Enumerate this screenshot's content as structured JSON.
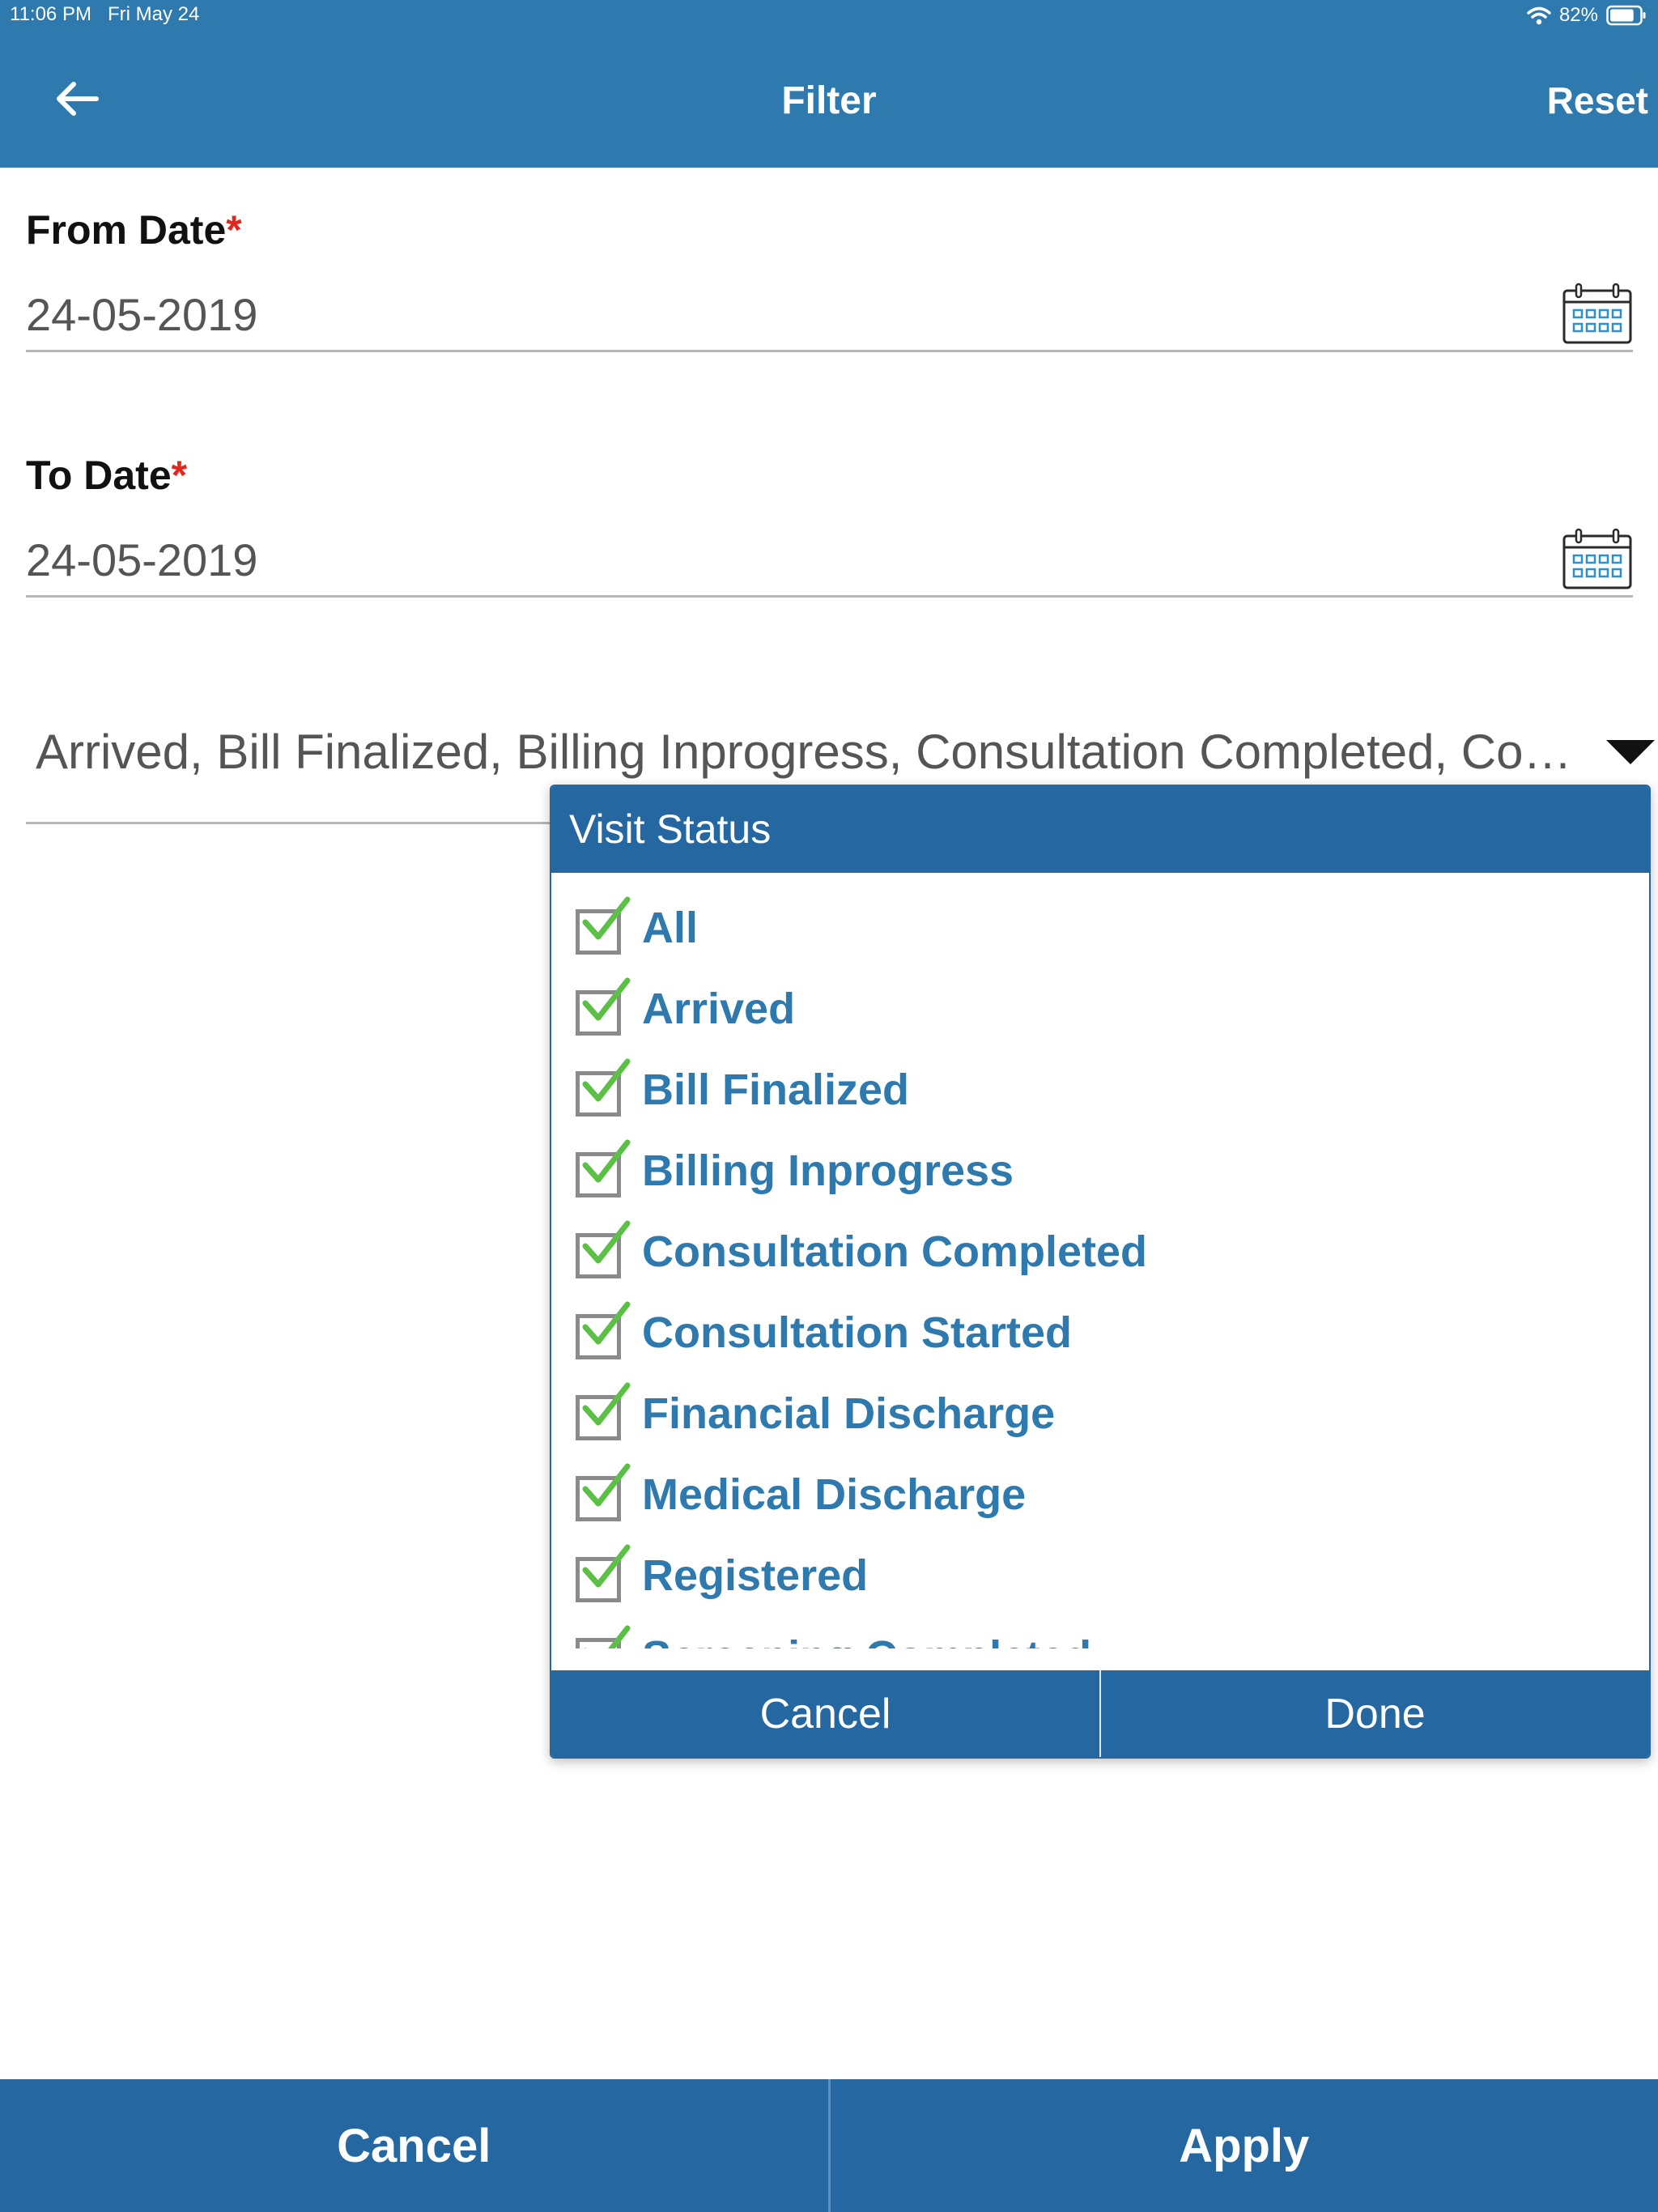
{
  "status_bar": {
    "time": "11:06 PM",
    "date": "Fri May 24",
    "battery": "82%",
    "battery_level": 0.82
  },
  "header": {
    "title": "Filter",
    "reset_label": "Reset",
    "back_icon": "arrow-left-icon"
  },
  "form": {
    "from_date": {
      "label": "From Date",
      "required_mark": "*",
      "value": "24-05-2019",
      "icon": "calendar-icon"
    },
    "to_date": {
      "label": "To Date",
      "required_mark": "*",
      "value": "24-05-2019",
      "icon": "calendar-icon"
    },
    "visit_status": {
      "selected_text": "Arrived, Bill Finalized, Billing Inprogress, Consultation Completed, Co…"
    }
  },
  "popup": {
    "title": "Visit Status",
    "options": [
      {
        "label": "All",
        "checked": true
      },
      {
        "label": "Arrived",
        "checked": true
      },
      {
        "label": "Bill Finalized",
        "checked": true
      },
      {
        "label": "Billing Inprogress",
        "checked": true
      },
      {
        "label": "Consultation Completed",
        "checked": true
      },
      {
        "label": "Consultation Started",
        "checked": true
      },
      {
        "label": "Financial Discharge",
        "checked": true
      },
      {
        "label": "Medical Discharge",
        "checked": true
      },
      {
        "label": "Registered",
        "checked": true
      },
      {
        "label": "Screening Completed",
        "checked": true
      }
    ],
    "cancel_label": "Cancel",
    "done_label": "Done"
  },
  "footer": {
    "cancel_label": "Cancel",
    "apply_label": "Apply"
  },
  "colors": {
    "header_blue": "#2e7aae",
    "bar_blue": "#2467a1",
    "required_red": "#e0281e",
    "check_green": "#5cc046"
  }
}
